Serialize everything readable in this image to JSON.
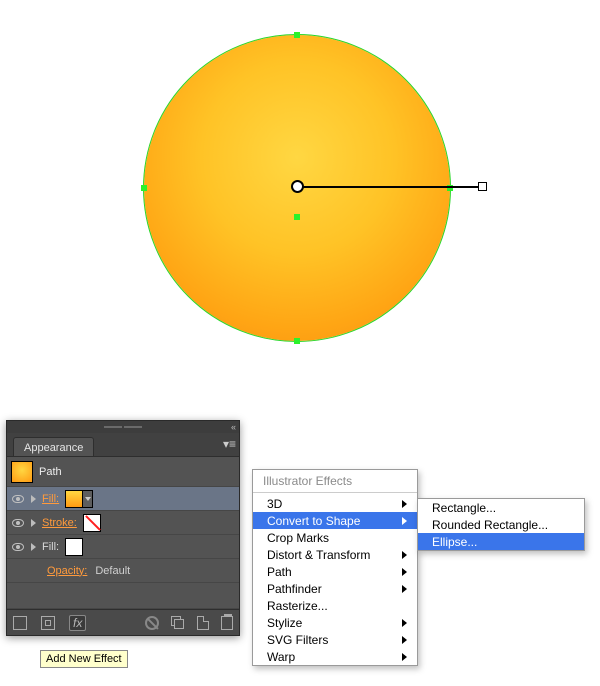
{
  "panel": {
    "tab_label": "Appearance",
    "object_label": "Path",
    "rows": [
      {
        "label": "Fill:",
        "link": true,
        "swatch": "grad",
        "selected": true,
        "eye": true
      },
      {
        "label": "Stroke:",
        "link": true,
        "swatch": "none",
        "selected": false,
        "eye": true
      },
      {
        "label": "Fill:",
        "link": false,
        "swatch": "white",
        "selected": false,
        "eye": true
      }
    ],
    "opacity_label": "Opacity:",
    "opacity_value": "Default",
    "fx_label": "fx",
    "tooltip": "Add New Effect"
  },
  "menu1": {
    "header": "Illustrator Effects",
    "items": [
      {
        "label": "3D",
        "submenu": true,
        "hi": false
      },
      {
        "label": "Convert to Shape",
        "submenu": true,
        "hi": true
      },
      {
        "label": "Crop Marks",
        "submenu": false,
        "hi": false
      },
      {
        "label": "Distort & Transform",
        "submenu": true,
        "hi": false
      },
      {
        "label": "Path",
        "submenu": true,
        "hi": false
      },
      {
        "label": "Pathfinder",
        "submenu": true,
        "hi": false
      },
      {
        "label": "Rasterize...",
        "submenu": false,
        "hi": false
      },
      {
        "label": "Stylize",
        "submenu": true,
        "hi": false
      },
      {
        "label": "SVG Filters",
        "submenu": true,
        "hi": false
      },
      {
        "label": "Warp",
        "submenu": true,
        "hi": false
      }
    ]
  },
  "menu2": {
    "items": [
      {
        "label": "Rectangle...",
        "hi": false
      },
      {
        "label": "Rounded Rectangle...",
        "hi": false
      },
      {
        "label": "Ellipse...",
        "hi": true
      }
    ]
  }
}
